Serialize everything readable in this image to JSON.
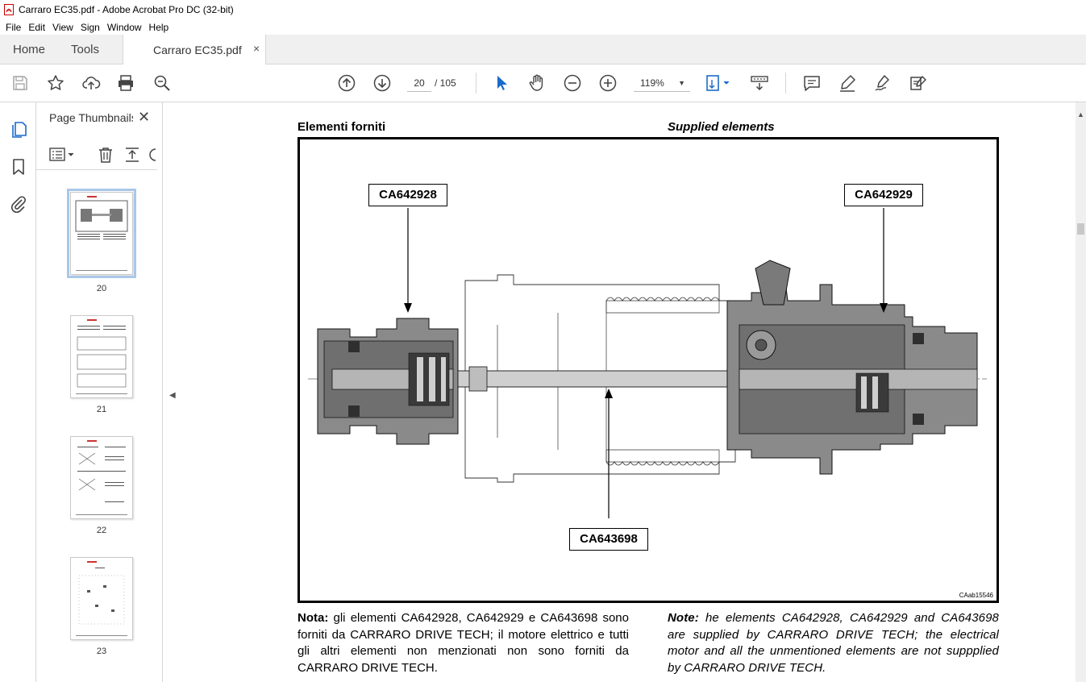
{
  "window": {
    "title": "Carraro EC35.pdf - Adobe Acrobat Pro DC (32-bit)"
  },
  "menu": [
    "File",
    "Edit",
    "View",
    "Sign",
    "Window",
    "Help"
  ],
  "tabs": {
    "home": "Home",
    "tools": "Tools",
    "document": "Carraro EC35.pdf",
    "close": "×"
  },
  "toolbar": {
    "current_page": "20",
    "page_total": "/ 105",
    "zoom": "119%"
  },
  "thumbnails_panel": {
    "title": "Page Thumbnails",
    "close": "✕",
    "pages": [
      "20",
      "21",
      "22",
      "23"
    ]
  },
  "document": {
    "heading_it": "Elementi forniti",
    "heading_en": "Supplied elements",
    "callouts": {
      "left": "CA642928",
      "right": "CA642929",
      "bottom": "CA643698"
    },
    "figure_code": "CAab15546",
    "note_it_label": "Nota:",
    "note_it_text": " gli elementi CA642928, CA642929 e CA643698 sono forniti da CARRARO DRIVE TECH; il motore elettrico e tutti gli altri elementi non menzionati non sono forniti da CARRARO DRIVE TECH.",
    "note_en_label": "Note:",
    "note_en_text": " he elements CA642928, CA642929 and CA643698 are supplied by CARRARO DRIVE TECH; the electrical motor and all the unmentioned elements are not suppplied by CARRARO DRIVE TECH."
  }
}
